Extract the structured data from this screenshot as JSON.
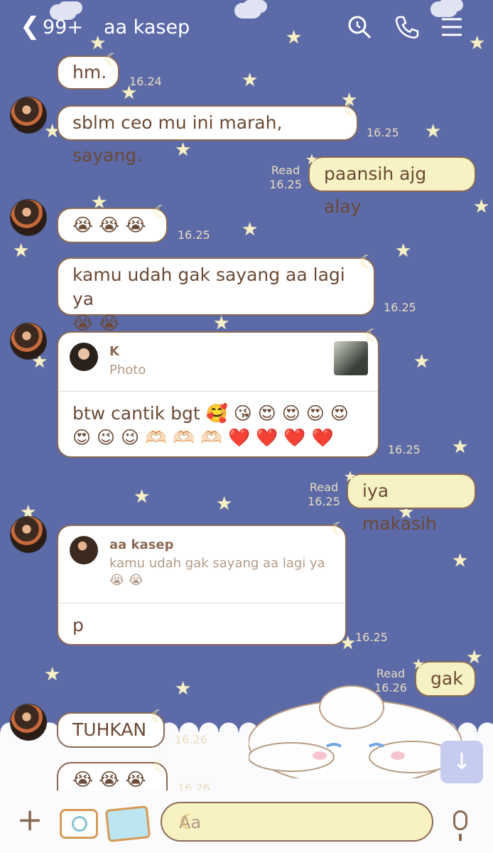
{
  "header": {
    "back_count": "99+",
    "chat_title": "aa kasep"
  },
  "messages": {
    "m1": {
      "text": "hm.",
      "time": "16.24"
    },
    "m2": {
      "text": "sblm ceo mu ini marah, sayang.",
      "time": "16.25"
    },
    "m3": {
      "text": "paansih ajg alay",
      "read": "Read",
      "time": "16.25"
    },
    "m4": {
      "text": "😭 😭 😭",
      "time": "16.25"
    },
    "m5": {
      "line1": "kamu udah gak sayang aa lagi ya",
      "line2": "😭 😭",
      "time": "16.25"
    },
    "m6": {
      "reply_name": "K",
      "reply_type": "Photo",
      "line1": "btw cantik bgt 🥰 😘 😍 😍 😍 😍",
      "line2": "😍 😉 😉 🫶🏻 🫶🏻 🫶🏻 ❤️ ❤️ ❤️ ❤️",
      "time": "16.25"
    },
    "m7": {
      "text": "iya makasih",
      "read": "Read",
      "time": "16.25"
    },
    "m8": {
      "reply_name": "aa kasep",
      "reply_line1": "kamu udah gak sayang aa lagi ya",
      "reply_line2": "😭 😭",
      "text": "p",
      "time": "16.25"
    },
    "m9": {
      "text": "gak",
      "read": "Read",
      "time": "16.26"
    },
    "m10": {
      "text": "TUHKAN",
      "time": "16.26"
    },
    "m11": {
      "text": "😭 😭 😭",
      "time": "16.26"
    }
  },
  "composer": {
    "placeholder": "Aa"
  },
  "colors": {
    "background": "#5c6aa8",
    "bubble_other": "#ffffff",
    "bubble_mine": "#f7f2c4",
    "bubble_border": "#8a6a54",
    "text": "#6b4a35"
  },
  "icons": [
    "back-chevron-icon",
    "search-icon",
    "phone-icon",
    "menu-icon",
    "moon-icon",
    "star-icon",
    "plus-icon",
    "camera-icon",
    "gallery-icon",
    "mic-icon",
    "arrow-down-icon"
  ]
}
